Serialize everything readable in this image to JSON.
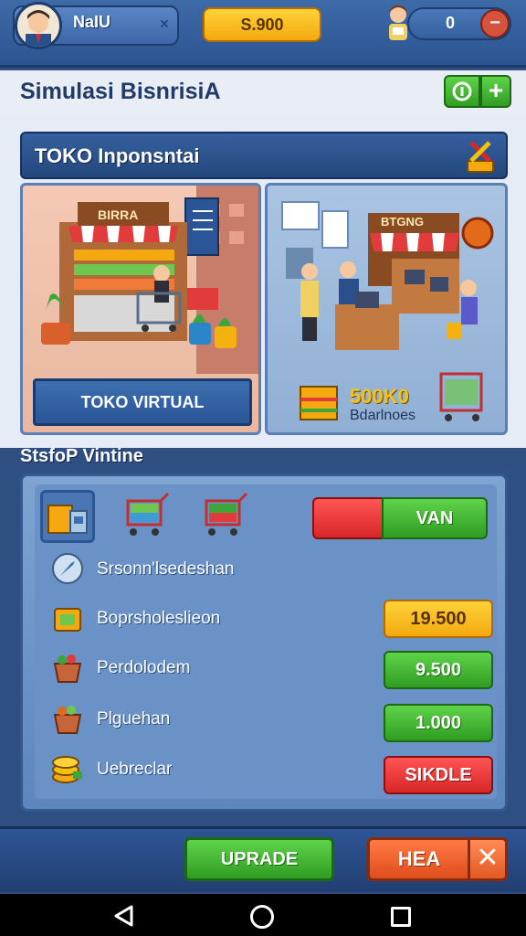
{
  "header": {
    "player_name": "NaIU",
    "coins": "S.900",
    "counter": "0",
    "minus_symbol": "−",
    "cross_symbol": "✕"
  },
  "title_bar": {
    "title": "Simulasi BisnrisiA",
    "plus_symbol": "+"
  },
  "store": {
    "title": "TOKO Inponsntai",
    "left_card": {
      "sign_text": "BIRRA",
      "button_label": "TOKO VIRTUAL"
    },
    "right_card": {
      "sign_text": "BTGNG",
      "price_value": "500K0",
      "price_sub": "Bdarlnoes"
    }
  },
  "section": {
    "title": "StsfoP Vintine",
    "toggle_label": "VAN",
    "rows": [
      {
        "label": "Srsonn'lsedeshan",
        "icon": "compass-icon"
      },
      {
        "label": "Boprsholeslieon",
        "icon": "crate-icon",
        "value": "19.500"
      },
      {
        "label": "Perdolodem",
        "icon": "produce-basket-icon",
        "value": "9.500"
      },
      {
        "label": "Plguehan",
        "icon": "fruit-basket-icon",
        "value": "1.000"
      },
      {
        "label": "Uebreclar",
        "icon": "coin-stack-icon",
        "value": "SIKDLE"
      }
    ]
  },
  "footer": {
    "upgrade_label": "UPRADE",
    "hea_label": "HEA",
    "close_symbol": "✕"
  },
  "colors": {
    "primary_blue": "#2f4f82",
    "accent_green": "#2f9d22",
    "accent_orange": "#f3a90f",
    "accent_red": "#d92626"
  }
}
